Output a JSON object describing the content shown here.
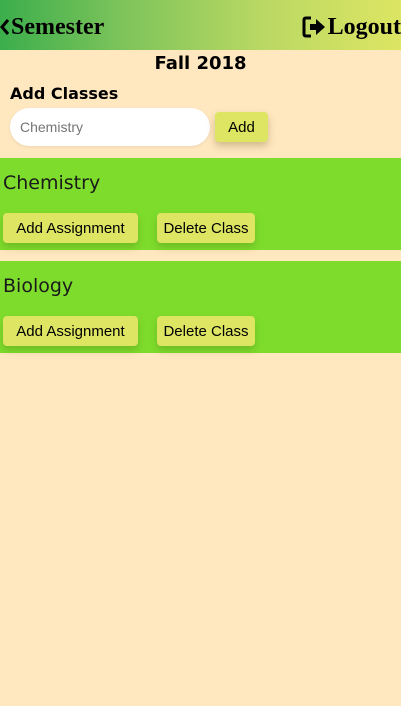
{
  "header": {
    "back_label": "Semester",
    "back_icon": "chevron-left-icon",
    "logout_label": "Logout",
    "logout_icon": "sign-out-icon"
  },
  "semester_title": "Fall 2018",
  "add_classes": {
    "heading": "Add Classes",
    "input_placeholder": "Chemistry",
    "input_value": "",
    "button_label": "Add"
  },
  "classes": [
    {
      "name": "Chemistry",
      "add_assignment_label": "Add Assignment",
      "delete_label": "Delete Class"
    },
    {
      "name": "Biology",
      "add_assignment_label": "Add Assignment",
      "delete_label": "Delete Class"
    }
  ],
  "colors": {
    "background": "#ffe7c0",
    "header_gradient_start": "#3bae4c",
    "header_gradient_end": "#dde563",
    "class_card": "#7edd2c",
    "button": "#dde563"
  }
}
